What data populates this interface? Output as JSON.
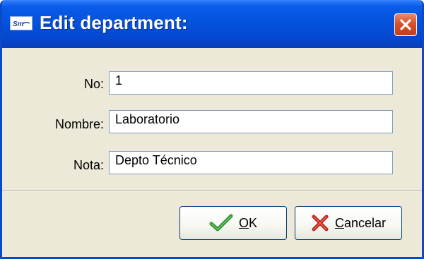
{
  "window": {
    "title": "Edit department:",
    "icon": "app-logo-icon",
    "close_icon": "close-icon"
  },
  "form": {
    "no": {
      "label": "No:",
      "value": "1"
    },
    "nombre": {
      "label": "Nombre:",
      "value": "Laboratorio"
    },
    "nota": {
      "label": "Nota:",
      "value": "Depto Técnico"
    }
  },
  "buttons": {
    "ok": {
      "label_accel": "O",
      "label_rest": "K",
      "icon": "checkmark-icon"
    },
    "cancel": {
      "label_accel": "C",
      "label_rest": "ancelar",
      "icon": "cross-icon"
    }
  },
  "colors": {
    "titlebar": "#0452dc",
    "window_body": "#ece9d8",
    "close_button": "#d8512b",
    "ok_icon": "#2e8b2e",
    "cancel_icon": "#b8231e"
  }
}
